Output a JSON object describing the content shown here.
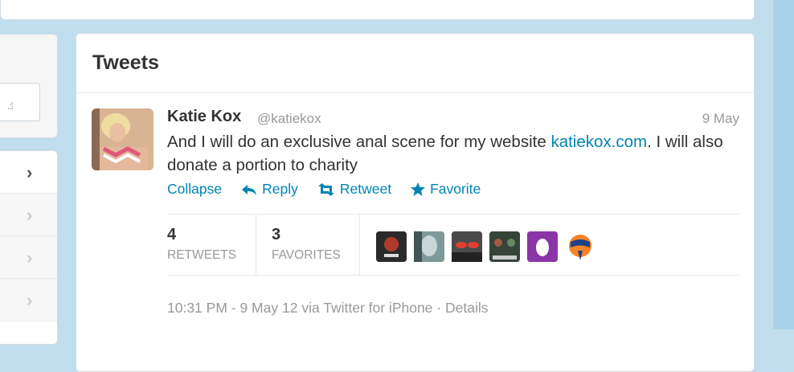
{
  "tweets_header": {
    "title": "Tweets"
  },
  "tweet": {
    "fullname": "Katie Kox",
    "username": "@katiekox",
    "time": "9 May",
    "text_before": "And I will do an exclusive anal scene for my website ",
    "link": "katiekox.com",
    "text_after": ". I will also donate a portion to charity",
    "actions": {
      "collapse": "Collapse",
      "reply": "Reply",
      "retweet": "Retweet",
      "favorite": "Favorite"
    },
    "stats": {
      "retweets_count": "4",
      "retweets_label": "RETWEETS",
      "favorites_count": "3",
      "favorites_label": "FAVORITES"
    },
    "favoriter_avatars": [
      {
        "name": "avatar-1",
        "color": "#2a2a2a"
      },
      {
        "name": "avatar-2",
        "color": "#8fa6a6"
      },
      {
        "name": "avatar-3",
        "color": "#3a3a3a"
      },
      {
        "name": "avatar-4",
        "color": "#3b4b3e"
      },
      {
        "name": "avatar-egg",
        "color": "#8b34a8"
      },
      {
        "name": "avatar-knicks",
        "color": "#f58426"
      }
    ],
    "meta": {
      "timestamp": "10:31 PM - 9 May 12",
      "via": "via Twitter for iPhone",
      "separator": "·",
      "details": "Details"
    }
  },
  "colors": {
    "link": "#0084b4",
    "background": "#c0deed"
  }
}
